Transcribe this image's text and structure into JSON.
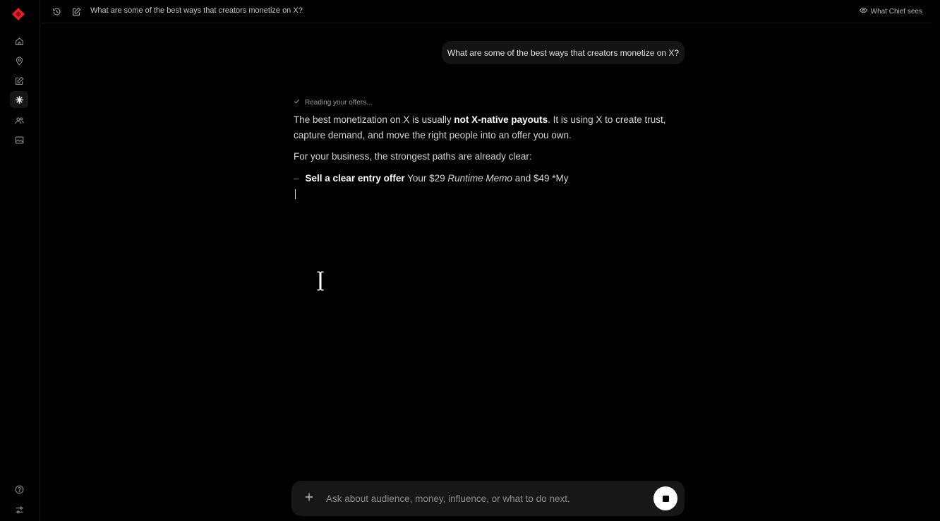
{
  "header": {
    "chat_title": "What are some of the best ways that creators monetize on X?",
    "what_chief_sees": "What Chief sees"
  },
  "sidebar": {
    "items": [
      {
        "name": "home",
        "icon": "home-icon"
      },
      {
        "name": "location",
        "icon": "map-pin-icon"
      },
      {
        "name": "write",
        "icon": "edit-icon"
      },
      {
        "name": "chief",
        "icon": "asterisk-icon",
        "active": true
      },
      {
        "name": "audience",
        "icon": "users-icon"
      },
      {
        "name": "media",
        "icon": "image-icon"
      }
    ],
    "bottom": [
      {
        "name": "help",
        "icon": "help-circle-icon"
      },
      {
        "name": "settings",
        "icon": "settings-sliders-icon"
      }
    ],
    "accent_color": "#e0202a"
  },
  "conversation": {
    "user_message": "What are some of the best ways that creators monetize on X?",
    "status": "Reading your offers...",
    "p1_a": "The best monetization on X is usually ",
    "p1_b": "not X-native payouts",
    "p1_c": ". It is using X to create trust, capture demand, and move the right people into an offer you own.",
    "p2": "For your business, the strongest paths are already clear:",
    "bullet_dash": "–",
    "bullet_bold": "Sell a clear entry offer",
    "bullet_a": " Your $29 ",
    "bullet_italic": "Runtime Memo",
    "bullet_b": " and $49 *My"
  },
  "composer": {
    "placeholder": "Ask about audience, money, influence, or what to do next.",
    "value": ""
  }
}
